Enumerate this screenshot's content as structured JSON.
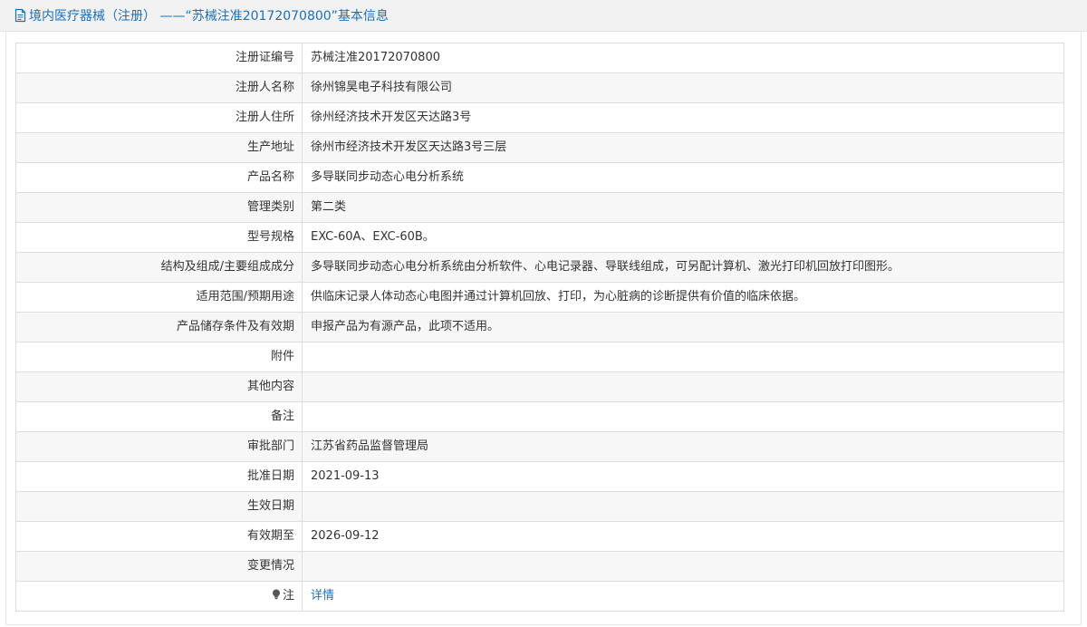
{
  "header": {
    "title": "境内医疗器械（注册） ——“苏械注准20172070800”基本信息",
    "icon": "document-icon"
  },
  "rows": [
    {
      "label": "注册证编号",
      "value": "苏械注准20172070800"
    },
    {
      "label": "注册人名称",
      "value": "徐州锦昊电子科技有限公司"
    },
    {
      "label": "注册人住所",
      "value": "徐州经济技术开发区天达路3号"
    },
    {
      "label": "生产地址",
      "value": "徐州市经济技术开发区天达路3号三层"
    },
    {
      "label": "产品名称",
      "value": "多导联同步动态心电分析系统"
    },
    {
      "label": "管理类别",
      "value": "第二类"
    },
    {
      "label": "型号规格",
      "value": "EXC-60A、EXC-60B。"
    },
    {
      "label": "结构及组成/主要组成成分",
      "value": "多导联同步动态心电分析系统由分析软件、心电记录器、导联线组成，可另配计算机、激光打印机回放打印图形。"
    },
    {
      "label": "适用范围/预期用途",
      "value": "供临床记录人体动态心电图并通过计算机回放、打印，为心脏病的诊断提供有价值的临床依据。"
    },
    {
      "label": "产品储存条件及有效期",
      "value": "申报产品为有源产品，此项不适用。"
    },
    {
      "label": "附件",
      "value": ""
    },
    {
      "label": "其他内容",
      "value": ""
    },
    {
      "label": "备注",
      "value": ""
    },
    {
      "label": "审批部门",
      "value": "江苏省药品监督管理局"
    },
    {
      "label": "批准日期",
      "value": "2021-09-13"
    },
    {
      "label": "生效日期",
      "value": ""
    },
    {
      "label": "有效期至",
      "value": "2026-09-12"
    },
    {
      "label": "变更情况",
      "value": ""
    }
  ],
  "note_row": {
    "label": "注",
    "icon": "lightbulb-icon",
    "link": "详情"
  },
  "colors": {
    "accent": "#1f6fb5",
    "header_bg": "#f2f2f2",
    "row_alt_bg": "#f7f7f7",
    "border": "#dddddd"
  }
}
